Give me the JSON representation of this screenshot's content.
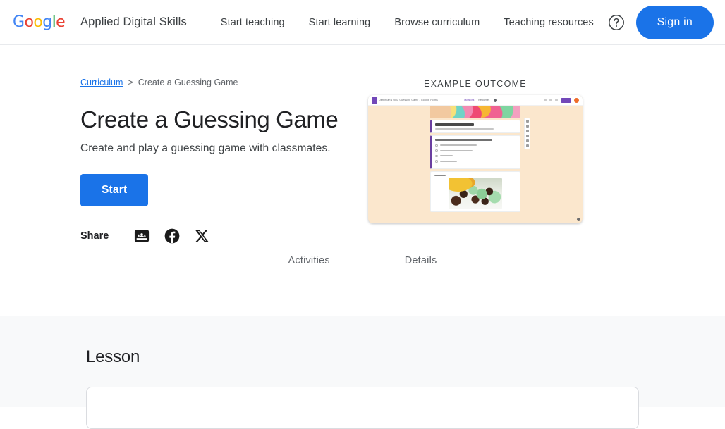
{
  "header": {
    "logo": {
      "letters": [
        "G",
        "o",
        "o",
        "g",
        "l",
        "e"
      ]
    },
    "brand": "Applied Digital Skills",
    "nav": [
      {
        "label": "Start teaching",
        "name": "nav-start-teaching"
      },
      {
        "label": "Start learning",
        "name": "nav-start-learning"
      },
      {
        "label": "Browse curriculum",
        "name": "nav-browse-curriculum"
      },
      {
        "label": "Teaching resources",
        "name": "nav-teaching-resources"
      }
    ],
    "help_icon": "help-circle-icon",
    "sign_in": "Sign in"
  },
  "breadcrumb": {
    "link": "Curriculum",
    "separator": ">",
    "current": "Create a Guessing Game"
  },
  "hero": {
    "title": "Create a Guessing Game",
    "subtitle": "Create and play a guessing game with classmates.",
    "start_button": "Start",
    "share_label": "Share",
    "share_icons": [
      {
        "name": "google-classroom-icon",
        "label": "Google Classroom"
      },
      {
        "name": "facebook-icon",
        "label": "Facebook"
      },
      {
        "name": "x-twitter-icon",
        "label": "X"
      }
    ]
  },
  "example_outcome": {
    "label": "EXAMPLE OUTCOME",
    "mockup": {
      "app": "google-forms",
      "chrome_title": "Jeremiah's Quiz Guessing Game - Google Forms",
      "tabs": [
        "Questions",
        "Responses"
      ],
      "send_button": "Send",
      "background_color": "#fbe7cd",
      "accent_color": "#7248b9",
      "option_count": 4
    }
  },
  "tabs": [
    {
      "label": "Activities",
      "name": "tab-activities"
    },
    {
      "label": "Details",
      "name": "tab-details"
    }
  ],
  "lesson": {
    "title": "Lesson"
  },
  "colors": {
    "primary": "#1a73e8",
    "text": "#202124",
    "muted": "#5f6368",
    "section_bg": "#f8f9fa"
  }
}
